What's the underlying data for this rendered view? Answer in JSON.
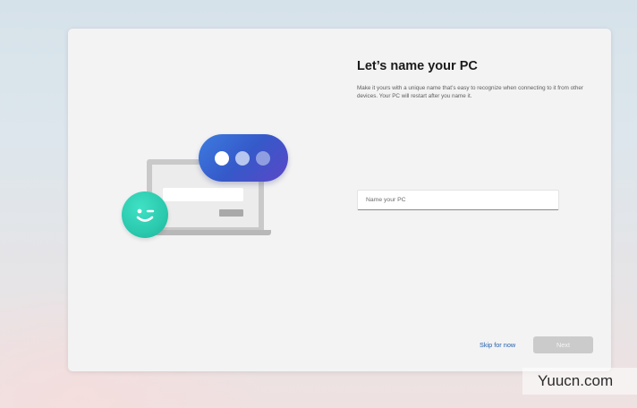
{
  "dialog": {
    "title": "Let’s name your PC",
    "description": "Make it yours with a unique name that’s easy to recognize when connecting to it from other devices. Your PC will restart after you name it.",
    "name_input": {
      "placeholder": "Name your PC",
      "value": ""
    },
    "skip_label": "Skip for now",
    "next_label": "Next"
  },
  "illustration": {
    "icons": [
      "laptop-icon",
      "chat-bubble-icon",
      "winking-smiley-icon"
    ],
    "colors": {
      "bubble": "#3559c9",
      "smiley": "#2bc9ad"
    }
  },
  "watermark": {
    "text": "Yuucn.com"
  }
}
